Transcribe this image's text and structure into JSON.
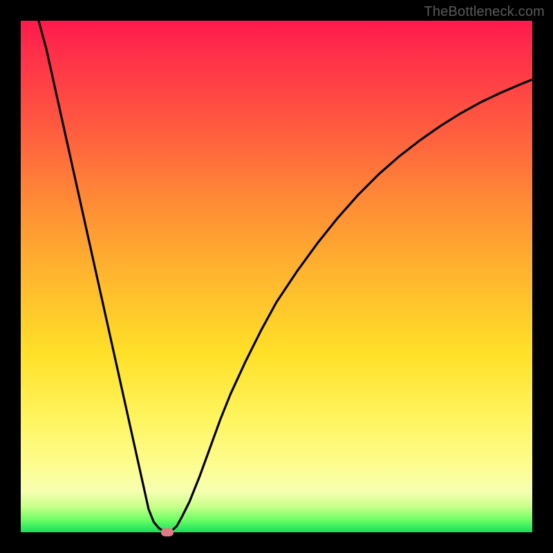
{
  "credit": {
    "text": "TheBottleneck.com"
  },
  "chart_data": {
    "type": "line",
    "title": "",
    "xlabel": "",
    "ylabel": "",
    "xlim": [
      0,
      100
    ],
    "ylim": [
      0,
      100
    ],
    "grid": false,
    "x": [
      3.5,
      5,
      6,
      7,
      8,
      9,
      10,
      11,
      12,
      13,
      14,
      15,
      16,
      17,
      18,
      19,
      20,
      21,
      22,
      23,
      24,
      25,
      26,
      27,
      28,
      28.7,
      29.5,
      30.5,
      31.5,
      33,
      35,
      37,
      39,
      41,
      44,
      47,
      50,
      54,
      58,
      62,
      66,
      70,
      74,
      78,
      82,
      86,
      90,
      94,
      98,
      100
    ],
    "y": [
      100,
      94.5,
      90,
      85.5,
      81,
      76.5,
      72,
      67.5,
      63,
      58.5,
      54,
      49.5,
      45,
      40.5,
      36,
      31.5,
      27,
      22.5,
      18,
      13.5,
      9,
      4.5,
      2,
      0.8,
      0.2,
      0,
      0.3,
      1.2,
      3,
      6,
      11,
      16.5,
      22,
      27,
      33.5,
      39.5,
      45,
      51,
      56.5,
      61.5,
      66,
      70,
      73.5,
      76.6,
      79.4,
      81.9,
      84.1,
      86,
      87.7,
      88.5
    ],
    "marker": {
      "x": 28.7,
      "y": 0
    }
  },
  "colors": {
    "curve": "#000000",
    "marker": "#e07a88"
  }
}
